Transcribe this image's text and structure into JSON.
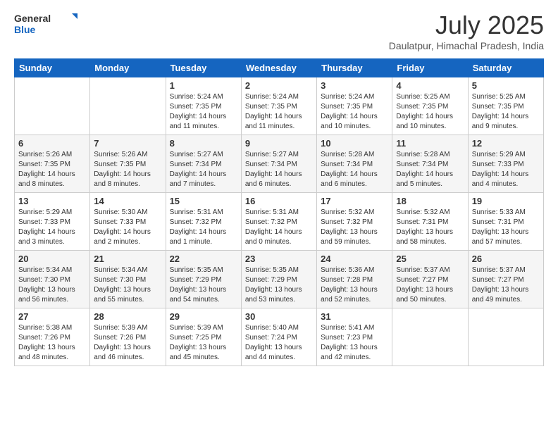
{
  "logo": {
    "general": "General",
    "blue": "Blue"
  },
  "title": "July 2025",
  "location": "Daulatpur, Himachal Pradesh, India",
  "weekdays": [
    "Sunday",
    "Monday",
    "Tuesday",
    "Wednesday",
    "Thursday",
    "Friday",
    "Saturday"
  ],
  "weeks": [
    [
      {
        "day": "",
        "info": ""
      },
      {
        "day": "",
        "info": ""
      },
      {
        "day": "1",
        "info": "Sunrise: 5:24 AM\nSunset: 7:35 PM\nDaylight: 14 hours and 11 minutes."
      },
      {
        "day": "2",
        "info": "Sunrise: 5:24 AM\nSunset: 7:35 PM\nDaylight: 14 hours and 11 minutes."
      },
      {
        "day": "3",
        "info": "Sunrise: 5:24 AM\nSunset: 7:35 PM\nDaylight: 14 hours and 10 minutes."
      },
      {
        "day": "4",
        "info": "Sunrise: 5:25 AM\nSunset: 7:35 PM\nDaylight: 14 hours and 10 minutes."
      },
      {
        "day": "5",
        "info": "Sunrise: 5:25 AM\nSunset: 7:35 PM\nDaylight: 14 hours and 9 minutes."
      }
    ],
    [
      {
        "day": "6",
        "info": "Sunrise: 5:26 AM\nSunset: 7:35 PM\nDaylight: 14 hours and 8 minutes."
      },
      {
        "day": "7",
        "info": "Sunrise: 5:26 AM\nSunset: 7:35 PM\nDaylight: 14 hours and 8 minutes."
      },
      {
        "day": "8",
        "info": "Sunrise: 5:27 AM\nSunset: 7:34 PM\nDaylight: 14 hours and 7 minutes."
      },
      {
        "day": "9",
        "info": "Sunrise: 5:27 AM\nSunset: 7:34 PM\nDaylight: 14 hours and 6 minutes."
      },
      {
        "day": "10",
        "info": "Sunrise: 5:28 AM\nSunset: 7:34 PM\nDaylight: 14 hours and 6 minutes."
      },
      {
        "day": "11",
        "info": "Sunrise: 5:28 AM\nSunset: 7:34 PM\nDaylight: 14 hours and 5 minutes."
      },
      {
        "day": "12",
        "info": "Sunrise: 5:29 AM\nSunset: 7:33 PM\nDaylight: 14 hours and 4 minutes."
      }
    ],
    [
      {
        "day": "13",
        "info": "Sunrise: 5:29 AM\nSunset: 7:33 PM\nDaylight: 14 hours and 3 minutes."
      },
      {
        "day": "14",
        "info": "Sunrise: 5:30 AM\nSunset: 7:33 PM\nDaylight: 14 hours and 2 minutes."
      },
      {
        "day": "15",
        "info": "Sunrise: 5:31 AM\nSunset: 7:32 PM\nDaylight: 14 hours and 1 minute."
      },
      {
        "day": "16",
        "info": "Sunrise: 5:31 AM\nSunset: 7:32 PM\nDaylight: 14 hours and 0 minutes."
      },
      {
        "day": "17",
        "info": "Sunrise: 5:32 AM\nSunset: 7:32 PM\nDaylight: 13 hours and 59 minutes."
      },
      {
        "day": "18",
        "info": "Sunrise: 5:32 AM\nSunset: 7:31 PM\nDaylight: 13 hours and 58 minutes."
      },
      {
        "day": "19",
        "info": "Sunrise: 5:33 AM\nSunset: 7:31 PM\nDaylight: 13 hours and 57 minutes."
      }
    ],
    [
      {
        "day": "20",
        "info": "Sunrise: 5:34 AM\nSunset: 7:30 PM\nDaylight: 13 hours and 56 minutes."
      },
      {
        "day": "21",
        "info": "Sunrise: 5:34 AM\nSunset: 7:30 PM\nDaylight: 13 hours and 55 minutes."
      },
      {
        "day": "22",
        "info": "Sunrise: 5:35 AM\nSunset: 7:29 PM\nDaylight: 13 hours and 54 minutes."
      },
      {
        "day": "23",
        "info": "Sunrise: 5:35 AM\nSunset: 7:29 PM\nDaylight: 13 hours and 53 minutes."
      },
      {
        "day": "24",
        "info": "Sunrise: 5:36 AM\nSunset: 7:28 PM\nDaylight: 13 hours and 52 minutes."
      },
      {
        "day": "25",
        "info": "Sunrise: 5:37 AM\nSunset: 7:27 PM\nDaylight: 13 hours and 50 minutes."
      },
      {
        "day": "26",
        "info": "Sunrise: 5:37 AM\nSunset: 7:27 PM\nDaylight: 13 hours and 49 minutes."
      }
    ],
    [
      {
        "day": "27",
        "info": "Sunrise: 5:38 AM\nSunset: 7:26 PM\nDaylight: 13 hours and 48 minutes."
      },
      {
        "day": "28",
        "info": "Sunrise: 5:39 AM\nSunset: 7:26 PM\nDaylight: 13 hours and 46 minutes."
      },
      {
        "day": "29",
        "info": "Sunrise: 5:39 AM\nSunset: 7:25 PM\nDaylight: 13 hours and 45 minutes."
      },
      {
        "day": "30",
        "info": "Sunrise: 5:40 AM\nSunset: 7:24 PM\nDaylight: 13 hours and 44 minutes."
      },
      {
        "day": "31",
        "info": "Sunrise: 5:41 AM\nSunset: 7:23 PM\nDaylight: 13 hours and 42 minutes."
      },
      {
        "day": "",
        "info": ""
      },
      {
        "day": "",
        "info": ""
      }
    ]
  ]
}
